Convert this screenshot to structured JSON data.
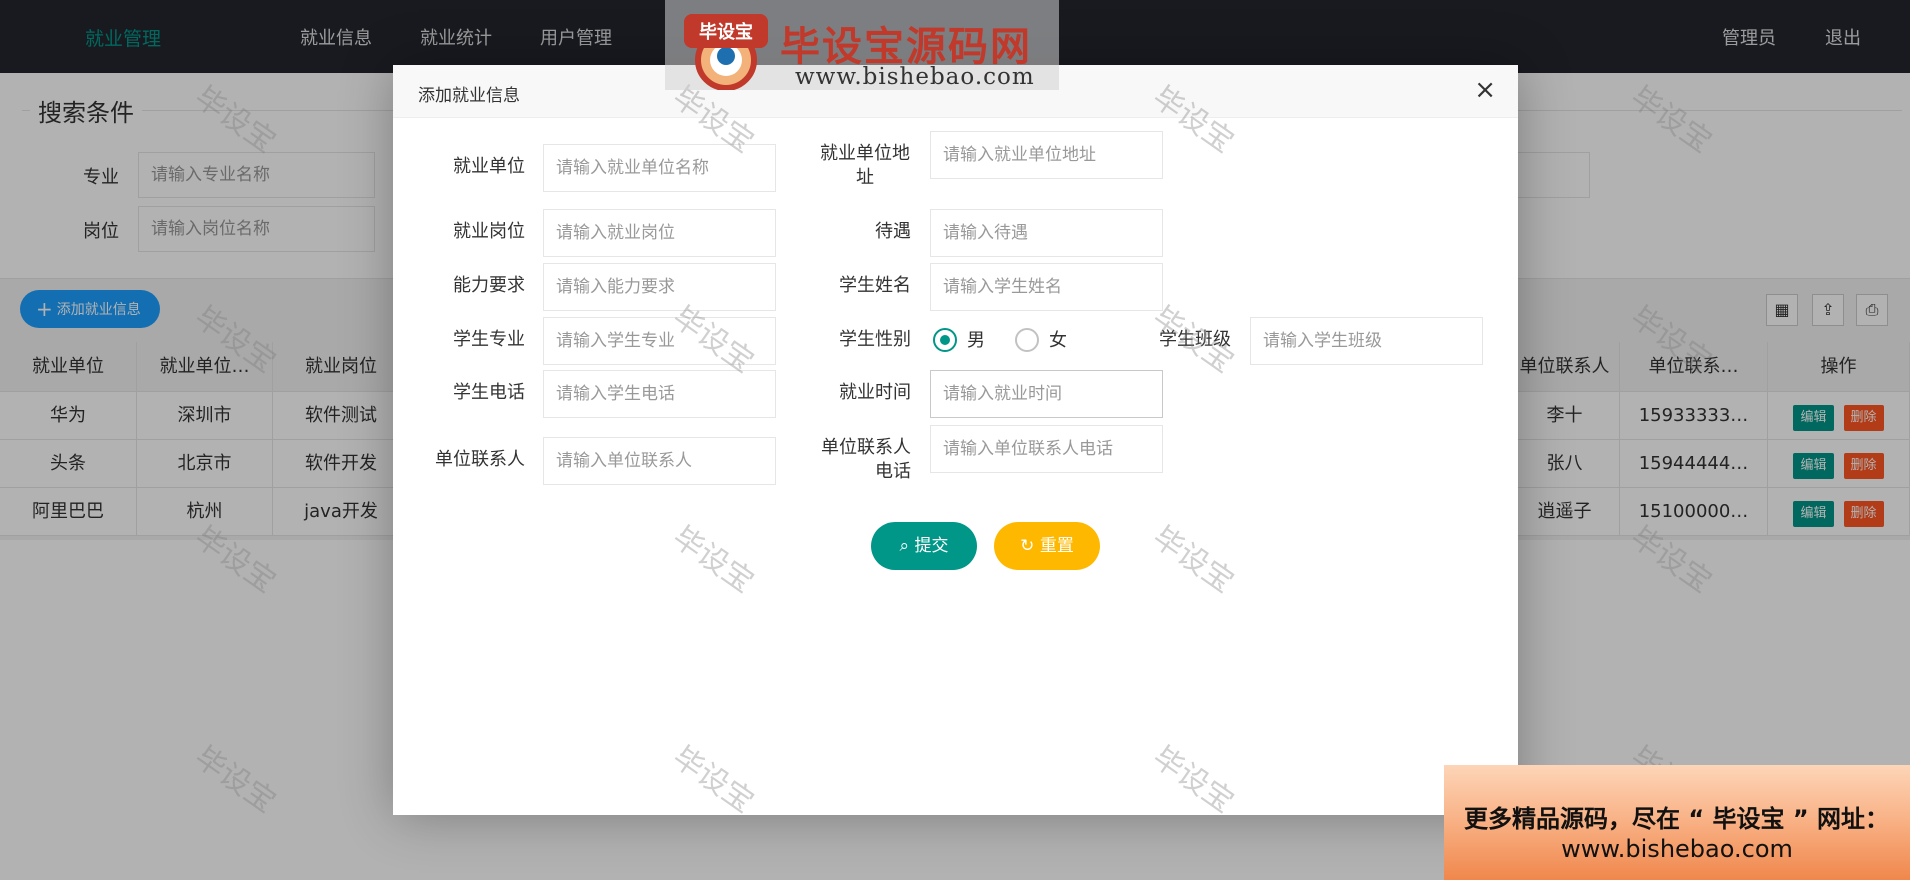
{
  "nav": {
    "logo": "就业管理",
    "items": [
      "就业信息",
      "就业统计",
      "用户管理"
    ],
    "user": "管理员",
    "logout": "退出"
  },
  "search": {
    "legend": "搜索条件",
    "major_label": "专业",
    "major_placeholder": "请输入专业名称",
    "position_label": "岗位",
    "position_placeholder": "请输入岗位名称"
  },
  "toolbar": {
    "add_label": "添加就业信息"
  },
  "table": {
    "left_headers": [
      "就业单位",
      "就业单位…",
      "就业岗位"
    ],
    "right_headers": [
      "单位联系人",
      "单位联系…",
      "操作"
    ],
    "rows": [
      {
        "company": "华为",
        "address": "深圳市",
        "post": "软件测试",
        "contact": "李十",
        "phone": "15933333…"
      },
      {
        "company": "头条",
        "address": "北京市",
        "post": "软件开发",
        "contact": "张八",
        "phone": "15944444…"
      },
      {
        "company": "阿里巴巴",
        "address": "杭州",
        "post": "java开发",
        "contact": "逍遥子",
        "phone": "15100000…"
      }
    ],
    "edit_label": "编辑",
    "delete_label": "删除"
  },
  "modal": {
    "title": "添加就业信息",
    "close": "×",
    "fields": {
      "company": {
        "label": "就业单位",
        "placeholder": "请输入就业单位名称"
      },
      "company_address": {
        "label": "就业单位地址",
        "placeholder": "请输入就业单位地址"
      },
      "post": {
        "label": "就业岗位",
        "placeholder": "请输入就业岗位"
      },
      "salary": {
        "label": "待遇",
        "placeholder": "请输入待遇"
      },
      "ability": {
        "label": "能力要求",
        "placeholder": "请输入能力要求"
      },
      "student_name": {
        "label": "学生姓名",
        "placeholder": "请输入学生姓名"
      },
      "student_major": {
        "label": "学生专业",
        "placeholder": "请输入学生专业"
      },
      "student_gender": {
        "label": "学生性别",
        "options": [
          "男",
          "女"
        ],
        "selected": "男"
      },
      "student_class": {
        "label": "学生班级",
        "placeholder": "请输入学生班级"
      },
      "student_phone": {
        "label": "学生电话",
        "placeholder": "请输入学生电话"
      },
      "employ_time": {
        "label": "就业时间",
        "placeholder": "请输入就业时间"
      },
      "contact": {
        "label": "单位联系人",
        "placeholder": "请输入单位联系人"
      },
      "contact_phone": {
        "label": "单位联系人电话",
        "placeholder": "请输入单位联系人电话"
      }
    },
    "submit_label": "提交",
    "reset_label": "重置"
  },
  "watermark": {
    "text": "毕设宝",
    "brand_cn": "毕设宝源码网",
    "brand_url": "www.bishebao.com",
    "seal_text": "毕设宝",
    "promo_line1": "更多精品源码，尽在 “ 毕设宝 ” 网址：",
    "promo_line2": "www.bishebao.com"
  },
  "colors": {
    "topbar": "#23262e",
    "accent": "#009688",
    "blue": "#1e9fff",
    "warm": "#ffb800",
    "danger": "#ff5722"
  }
}
